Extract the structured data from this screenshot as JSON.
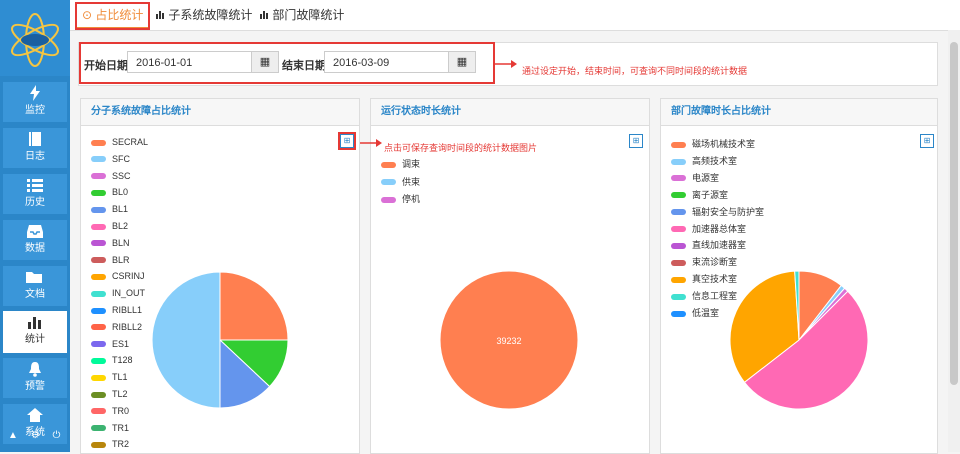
{
  "sidebar": {
    "items": [
      {
        "label": "监控",
        "icon": "bolt-icon"
      },
      {
        "label": "日志",
        "icon": "book-icon"
      },
      {
        "label": "历史",
        "icon": "list-icon"
      },
      {
        "label": "数据",
        "icon": "inbox-icon"
      },
      {
        "label": "文档",
        "icon": "folder-icon"
      },
      {
        "label": "统计",
        "icon": "bar-chart-icon"
      },
      {
        "label": "预警",
        "icon": "bell-icon"
      },
      {
        "label": "系统",
        "icon": "home-icon"
      }
    ]
  },
  "tabs": [
    {
      "label": "占比统计",
      "icon": "clock-icon"
    },
    {
      "label": "子系统故障统计",
      "icon": "bar-chart-icon"
    },
    {
      "label": "部门故障统计",
      "icon": "bar-chart-icon"
    }
  ],
  "filter": {
    "start_label": "开始日期",
    "start_value": "2016-01-01",
    "end_label": "结束日期",
    "end_value": "2016-03-09",
    "note": "通过设定开始，结束时间，可查询不同时间段的统计数据"
  },
  "cards": {
    "subsystem": {
      "title": "分子系统故障占比统计",
      "legend": [
        "SECRAL",
        "SFC",
        "SSC",
        "BL0",
        "BL1",
        "BL2",
        "BLN",
        "BLR",
        "CSRINJ",
        "IN_OUT",
        "RIBLL1",
        "RIBLL2",
        "ES1",
        "T128",
        "TL1",
        "TL2",
        "TR0",
        "TR1",
        "TR2"
      ],
      "colors": [
        "#ff7f50",
        "#87cefa",
        "#da70d6",
        "#32cd32",
        "#6495ed",
        "#ff69b4",
        "#ba55d3",
        "#cd5c5c",
        "#ffa500",
        "#40e0d0",
        "#1e90ff",
        "#ff6347",
        "#7b68ee",
        "#00fa9a",
        "#ffd700",
        "#6b8e23",
        "#ff6666",
        "#3cb371",
        "#b8860b"
      ]
    },
    "runtime": {
      "title": "运行状态时长统计",
      "legend": [
        "调束",
        "供束",
        "停机"
      ],
      "colors": [
        "#ff7f50",
        "#87cefa",
        "#da70d6"
      ],
      "save_note": "点击可保存查询时间段的统计数据图片"
    },
    "department": {
      "title": "部门故障时长占比统计",
      "legend": [
        "磁场机械技术室",
        "高频技术室",
        "电源室",
        "离子源室",
        "辐射安全与防护室",
        "加速器总体室",
        "直线加速器室",
        "束流诊断室",
        "真空技术室",
        "信息工程室",
        "低温室"
      ],
      "colors": [
        "#ff7f50",
        "#87cefa",
        "#da70d6",
        "#32cd32",
        "#6495ed",
        "#ff69b4",
        "#ba55d3",
        "#cd5c5c",
        "#ffa500",
        "#40e0d0",
        "#1e90ff"
      ]
    }
  },
  "chart_data": [
    {
      "type": "pie",
      "title": "分子系统故障占比统计",
      "slices": [
        {
          "name": "SECRAL",
          "value": 25
        },
        {
          "name": "BL0",
          "value": 12
        },
        {
          "name": "BL1",
          "value": 13
        },
        {
          "name": "SFC",
          "value": 50
        }
      ]
    },
    {
      "type": "pie",
      "title": "运行状态时长统计",
      "slices": [
        {
          "name": "调束",
          "value": 39232
        }
      ]
    },
    {
      "type": "pie",
      "title": "部门故障时长占比统计",
      "slices": [
        {
          "name": "磁场机械技术室",
          "value": 10.5
        },
        {
          "name": "高频技术室",
          "value": 1
        },
        {
          "name": "电源室",
          "value": 1
        },
        {
          "name": "加速器总体室",
          "value": 52
        },
        {
          "name": "真空技术室",
          "value": 34.5
        },
        {
          "name": "信息工程室",
          "value": 1
        }
      ]
    }
  ]
}
